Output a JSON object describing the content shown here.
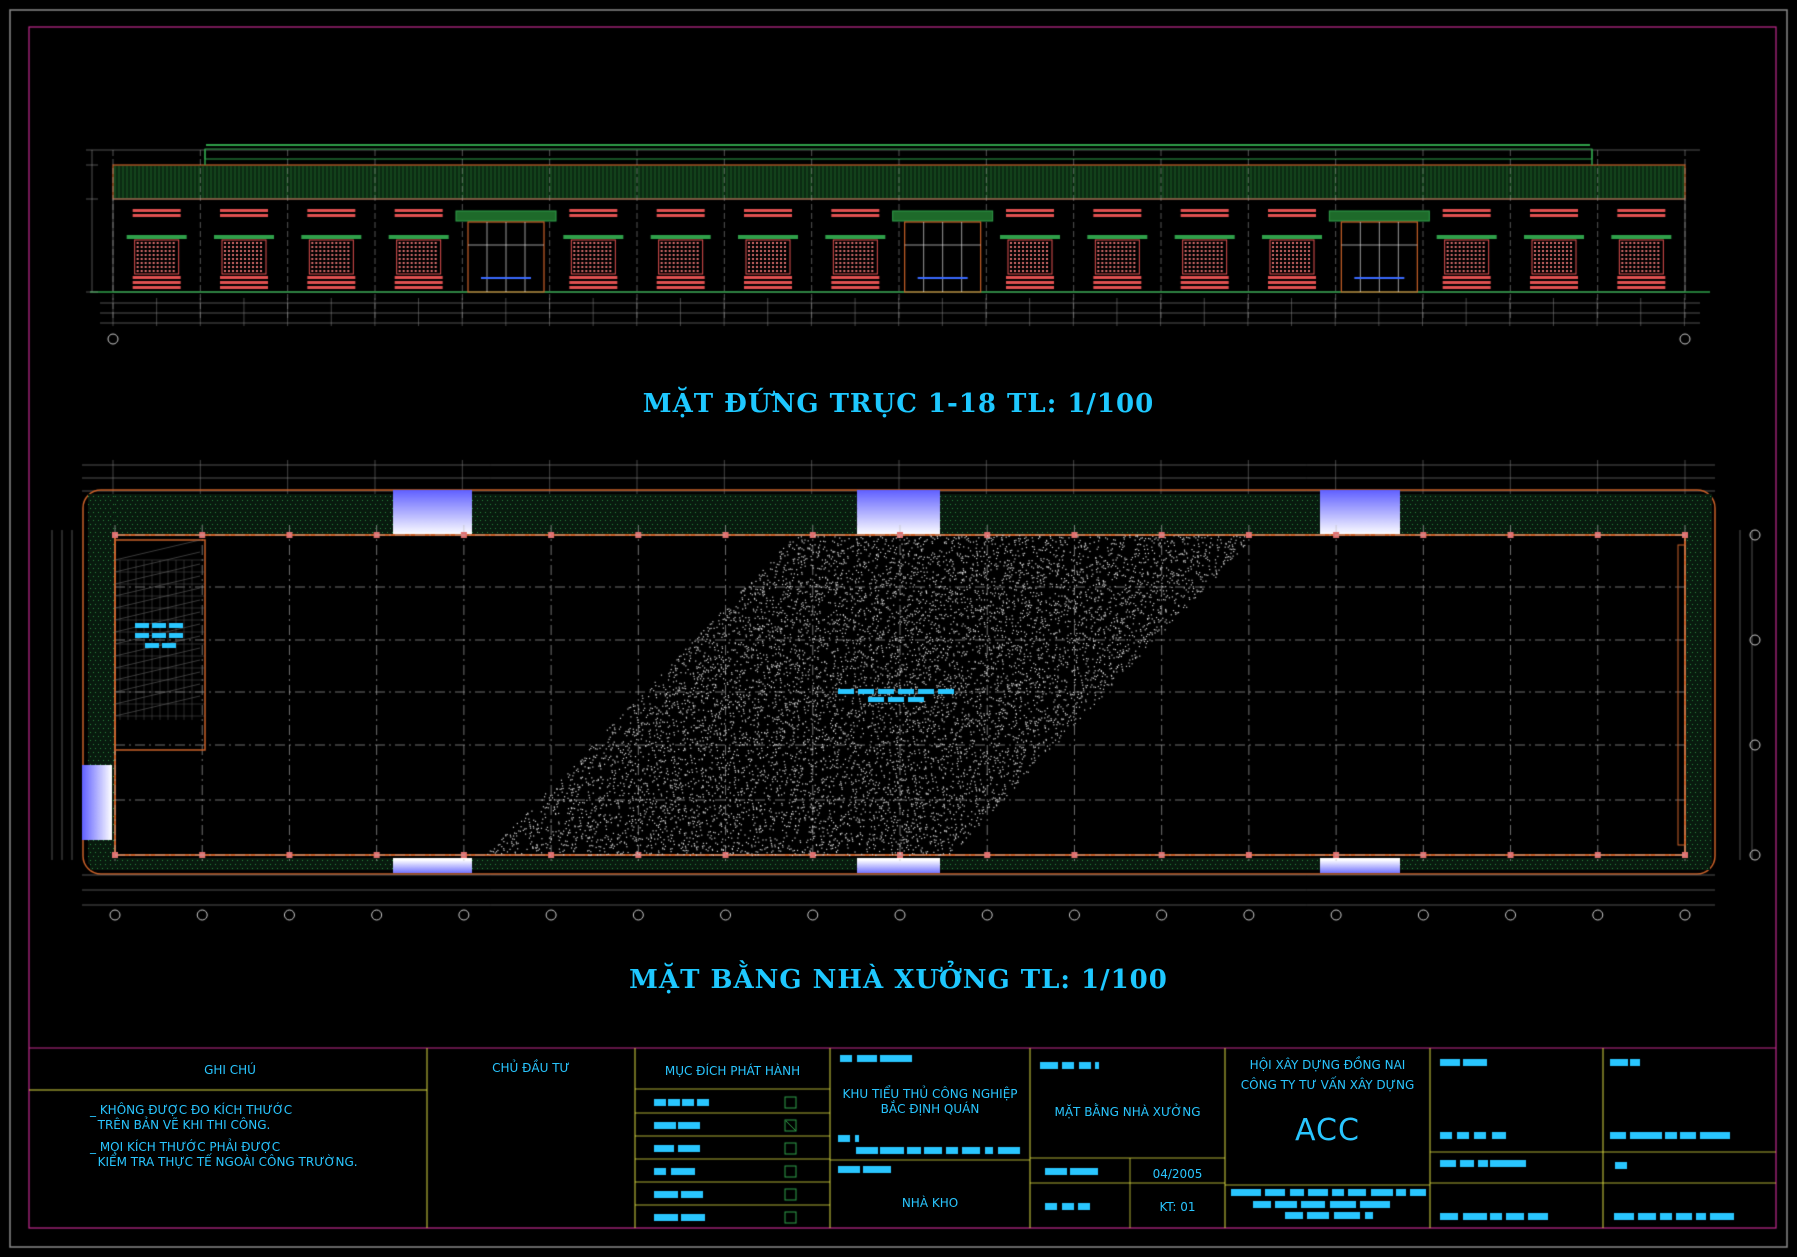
{
  "drawing": {
    "elevation_title": "MẶT ĐỨNG TRỤC 1-18 TL: 1/100",
    "plan_title": "MẶT BẰNG NHÀ XƯỞNG TL: 1/100"
  },
  "title_block": {
    "notes_header": "GHI CHÚ",
    "owner_header": "CHỦ ĐẦU TƯ",
    "purpose_header": "MỤC ĐÍCH PHÁT HÀNH",
    "notes": [
      "_ KHÔNG ĐƯỢC ĐO KÍCH THƯỚC\n  TRÊN BẢN VẼ KHI THI CÔNG.",
      "_ MỌI KÍCH THƯỚC PHẢI ĐƯỢC\n  KIỂM TRA THỰC TẾ NGOÀI CÔNG TRƯỜNG."
    ],
    "project_name": "KHU TIỂU THỦ CÔNG NGHIỆP\nBẮC ĐỊNH QUÁN",
    "building_name": "NHÀ KHO",
    "sheet_title": "MẶT BẰNG NHÀ XƯỞNG",
    "date": "04/2005",
    "sheet_code": "KT: 01",
    "association": "HỘI XÂY DỰNG ĐỒNG NAI",
    "company": "CÔNG TY TƯ VẤN XÂY DỰNG",
    "company_short": "ACC"
  },
  "colors": {
    "background": "#000000",
    "accent_cyan": "#1ec8ff",
    "frame_magenta": "#c0288c",
    "frame_yellow": "#d8d840",
    "wall_orange": "#c86028",
    "hatch_green": "#2fa04a",
    "window_red": "#e05050",
    "opening_blue": "#9090ff"
  }
}
